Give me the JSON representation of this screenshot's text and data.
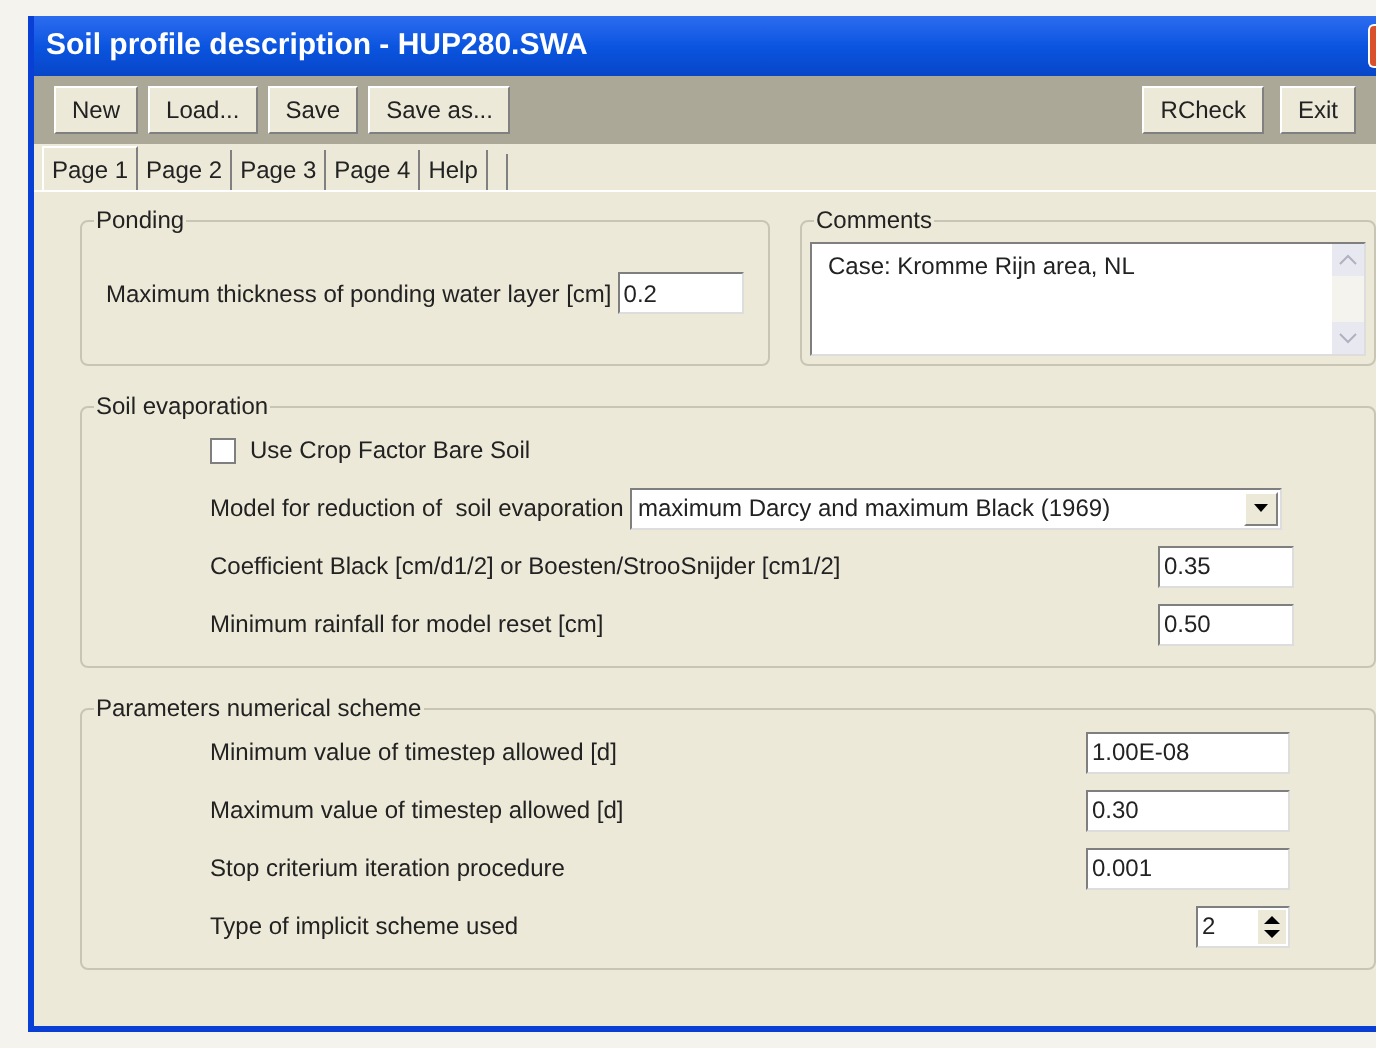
{
  "window": {
    "title": "Soil profile description - HUP280.SWA"
  },
  "toolbar": {
    "left": [
      "New",
      "Load...",
      "Save",
      "Save as..."
    ],
    "right": [
      "RCheck",
      "Exit"
    ]
  },
  "tabs": [
    {
      "label": "Page 1",
      "selected": true
    },
    {
      "label": "Page 2",
      "selected": false
    },
    {
      "label": "Page 3",
      "selected": false
    },
    {
      "label": "Page 4",
      "selected": false
    },
    {
      "label": "Help",
      "selected": false
    }
  ],
  "ponding": {
    "title": "Ponding",
    "label": "Maximum thickness of ponding water layer [cm]",
    "value": "0.2"
  },
  "comments": {
    "title": "Comments",
    "value": "Case: Kromme Rijn area, NL"
  },
  "soil_evaporation": {
    "title": "Soil evaporation",
    "rows": [
      {
        "kind": "checkbox",
        "label": "Use Crop Factor Bare Soil",
        "checked": false
      },
      {
        "kind": "select",
        "label": "Model for reduction of  soil evaporation",
        "value": "maximum Darcy and maximum Black (1969)"
      },
      {
        "kind": "input",
        "label": "Coefficient Black [cm/d1/2] or Boesten/StrooSnijder [cm1/2]",
        "value": "0.35"
      },
      {
        "kind": "input",
        "label": "Minimum rainfall for model reset [cm]",
        "value": "0.50"
      }
    ]
  },
  "numerical_scheme": {
    "title": "Parameters numerical scheme",
    "rows": [
      {
        "kind": "input",
        "label": "Minimum value of timestep allowed [d]",
        "value": "1.00E-08"
      },
      {
        "kind": "input",
        "label": "Maximum value of timestep allowed [d]",
        "value": "0.30"
      },
      {
        "kind": "input",
        "label": "Stop criterium iteration procedure",
        "value": "0.001"
      },
      {
        "kind": "spinner",
        "label": "Type of implicit scheme used",
        "value": "2"
      }
    ]
  }
}
